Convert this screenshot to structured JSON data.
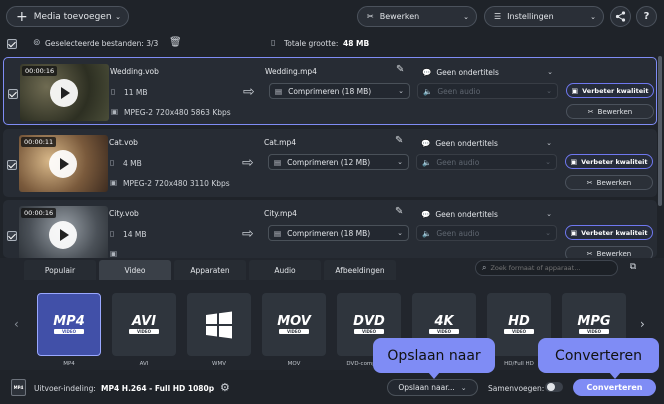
{
  "toolbar": {
    "add_media_label": "Media toevoegen",
    "edit_label": "Bewerken",
    "settings_label": "Instellingen",
    "help_label": "?"
  },
  "selection": {
    "selected_label": "Geselecteerde bestanden: 3/3",
    "total_label": "Totale grootte:",
    "total_value": "48 MB"
  },
  "files": [
    {
      "duration": "00:00:16",
      "name": "Wedding.vob",
      "size": "11 MB",
      "info": "MPEG-2 720x480 5863 Kbps",
      "output": "Wedding.mp4",
      "compress": "Comprimeren (18 MB)",
      "subtitles": "Geen ondertitels",
      "audio": "Geen audio",
      "enhance": "Verbeter kwaliteit",
      "edit": "Bewerken"
    },
    {
      "duration": "00:00:11",
      "name": "Cat.vob",
      "size": "4 MB",
      "info": "MPEG-2 720x480 3110 Kbps",
      "output": "Cat.mp4",
      "compress": "Comprimeren (12 MB)",
      "subtitles": "Geen ondertitels",
      "audio": "Geen audio",
      "enhance": "Verbeter kwaliteit",
      "edit": "Bewerken"
    },
    {
      "duration": "00:00:16",
      "name": "City.vob",
      "size": "14 MB",
      "info": "",
      "output": "City.mp4",
      "compress": "Comprimeren (18 MB)",
      "subtitles": "Geen ondertitels",
      "audio": "Geen audio",
      "enhance": "Verbeter kwaliteit",
      "edit": "Bewerken"
    }
  ],
  "tabs": [
    "Populair",
    "Video",
    "Apparaten",
    "Audio",
    "Afbeeldingen"
  ],
  "active_tab": "Video",
  "search": {
    "placeholder": "Zoek formaat of apparaat..."
  },
  "formats": [
    {
      "logo": "MP4",
      "label": "MP4"
    },
    {
      "logo": "AVI",
      "label": "AVI"
    },
    {
      "logo": "",
      "label": "WMV"
    },
    {
      "logo": "MOV",
      "label": "MOV"
    },
    {
      "logo": "DVD",
      "label": "DVD-compatib..."
    },
    {
      "logo": "4K",
      "label": "4K"
    },
    {
      "logo": "HD",
      "label": "HD/Full HD"
    },
    {
      "logo": "MPG",
      "label": "MPG"
    }
  ],
  "format_sublabels": [
    "VIDEO",
    "VIDEO",
    "VIDEO",
    "VIDEO",
    "VIDEO",
    "VIDEO",
    "VIDEO"
  ],
  "bottom": {
    "output_label": "Uitvoer-indeling:",
    "output_value": "MP4 H.264 - Full HD 1080p",
    "save_to": "Opslaan naar...",
    "merge_label": "Samenvoegen:",
    "convert": "Converteren"
  },
  "callouts": {
    "save": "Opslaan naar",
    "convert": "Converteren"
  },
  "colors": {
    "accent": "#7f8cf5",
    "active_format": "#4150a8",
    "background": "#1f2329"
  }
}
